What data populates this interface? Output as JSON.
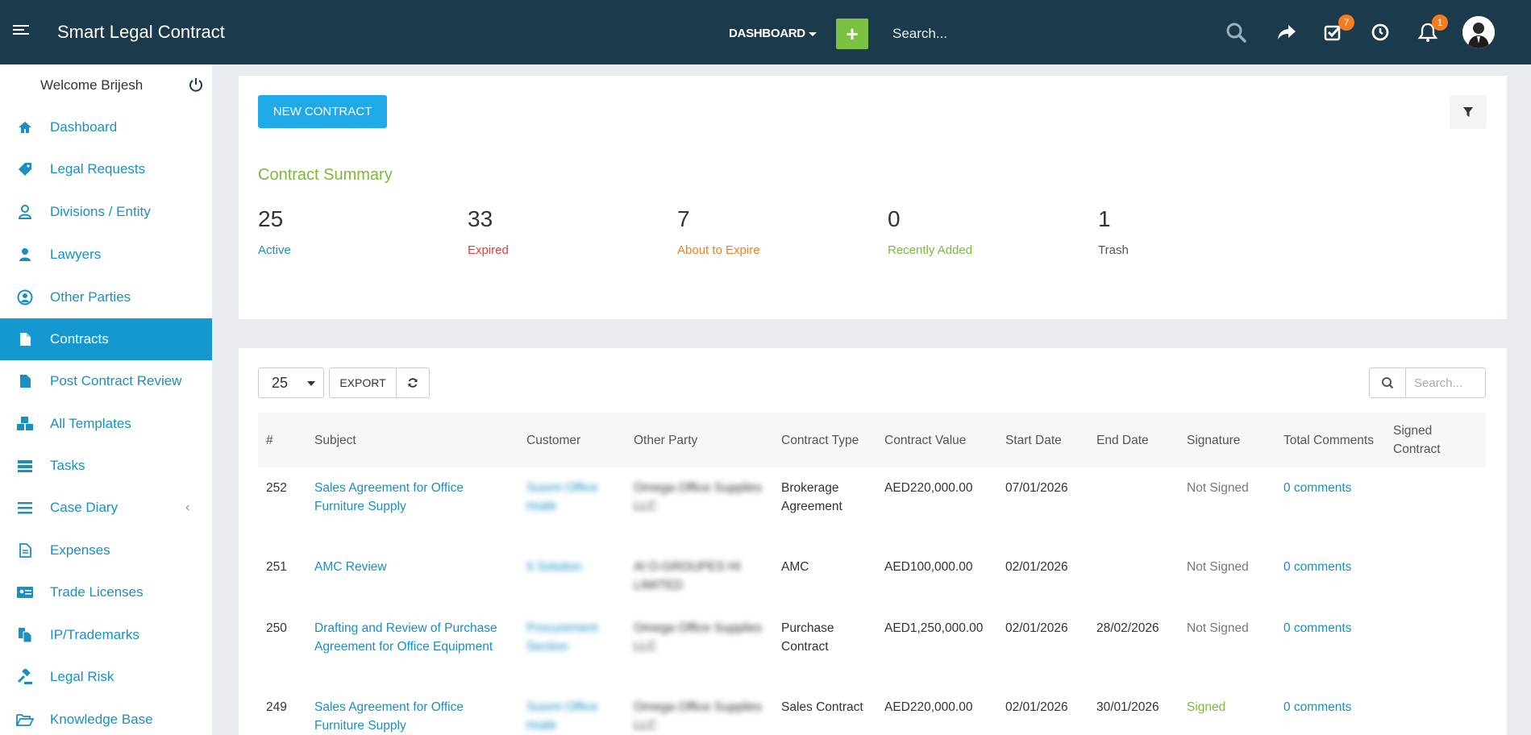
{
  "app": {
    "title": "Smart Legal Contract",
    "dashboard_menu": "DASHBOARD",
    "add_label": "+",
    "search_placeholder": "Search...",
    "tasks_badge": "7",
    "notifications_badge": "1"
  },
  "sidebar": {
    "welcome": "Welcome Brijesh",
    "items": [
      {
        "label": "Dashboard",
        "icon": "home-icon"
      },
      {
        "label": "Legal Requests",
        "icon": "tag-icon"
      },
      {
        "label": "Divisions / Entity",
        "icon": "user-outline-icon"
      },
      {
        "label": "Lawyers",
        "icon": "user-icon"
      },
      {
        "label": "Other Parties",
        "icon": "user-circle-icon"
      },
      {
        "label": "Contracts",
        "icon": "file-icon",
        "active": true
      },
      {
        "label": "Post Contract Review",
        "icon": "file-icon"
      },
      {
        "label": "All Templates",
        "icon": "cubes-icon"
      },
      {
        "label": "Tasks",
        "icon": "tasks-icon"
      },
      {
        "label": "Case Diary",
        "icon": "list-icon",
        "chevron": "‹"
      },
      {
        "label": "Expenses",
        "icon": "file-text-icon"
      },
      {
        "label": "Trade Licenses",
        "icon": "id-card-icon"
      },
      {
        "label": "IP/Trademarks",
        "icon": "copy-icon"
      },
      {
        "label": "Legal Risk",
        "icon": "gavel-icon"
      },
      {
        "label": "Knowledge Base",
        "icon": "folder-open-icon"
      }
    ]
  },
  "summary": {
    "new_contract_label": "NEW CONTRACT",
    "title": "Contract Summary",
    "stats": [
      {
        "value": "25",
        "label": "Active",
        "color": "#1a8fc0"
      },
      {
        "value": "33",
        "label": "Expired",
        "color": "#e03b3b"
      },
      {
        "value": "7",
        "label": "About to Expire",
        "color": "#f57c20"
      },
      {
        "value": "0",
        "label": "Recently Added",
        "color": "#7cb83a"
      },
      {
        "value": "1",
        "label": "Trash",
        "color": "#555555"
      }
    ]
  },
  "table_controls": {
    "page_size": "25",
    "export_label": "EXPORT",
    "search_placeholder": "Search..."
  },
  "table": {
    "headers": [
      "#",
      "Subject",
      "Customer",
      "Other Party",
      "Contract Type",
      "Contract Value",
      "Start Date",
      "End Date",
      "Signature",
      "Total Comments",
      "Signed Contract"
    ],
    "rows": [
      {
        "id": "252",
        "subject": "Sales Agreement for Office Furniture Supply",
        "customer": "Suomi Office Hubb",
        "other_party": "Omega Office Supplies LLC",
        "type": "Brokerage Agreement",
        "value": "AED220,000.00",
        "start": "07/01/2026",
        "end": "",
        "signature": "Not Signed",
        "comments": "0 comments"
      },
      {
        "id": "251",
        "subject": "AMC Review",
        "customer": "It Solution",
        "other_party": "Al O-GROUPES HI LIMITED",
        "type": "AMC",
        "value": "AED100,000.00",
        "start": "02/01/2026",
        "end": "",
        "signature": "Not Signed",
        "comments": "0 comments"
      },
      {
        "id": "250",
        "subject": "Drafting and Review of Purchase Agreement for Office Equipment",
        "customer": "Procurement Section",
        "other_party": "Omega Office Supplies LLC",
        "type": "Purchase Contract",
        "value": "AED1,250,000.00",
        "start": "02/01/2026",
        "end": "28/02/2026",
        "signature": "Not Signed",
        "comments": "0 comments"
      },
      {
        "id": "249",
        "subject": "Sales Agreement for Office Furniture Supply",
        "customer": "Suomi Office Hubb",
        "other_party": "Omega Office Supplies LLC",
        "type": "Sales Contract",
        "value": "AED220,000.00",
        "start": "02/01/2026",
        "end": "30/01/2026",
        "signature": "Signed",
        "comments": "0 comments"
      }
    ]
  }
}
